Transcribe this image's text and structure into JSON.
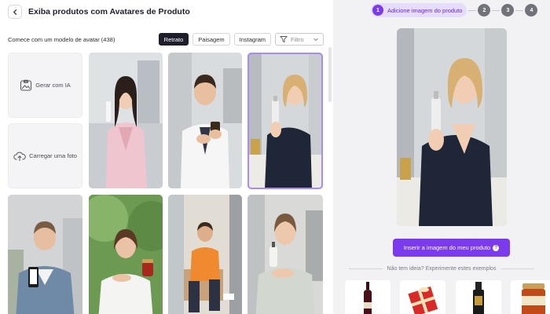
{
  "header": {
    "title": "Exiba produtos com Avatares de Produto"
  },
  "toolbar": {
    "subtitle": "Comece com um modelo de avatar (438)",
    "chips": [
      "Retrato",
      "Paisagem",
      "Instagram"
    ],
    "filter_label": "Filtro"
  },
  "tiles": {
    "generate_label": "Gerar com IA",
    "upload_label": "Carregar uma foto"
  },
  "avatars": [
    {
      "name": "woman-robe-serum",
      "selected": false
    },
    {
      "name": "man-labcoat-jar",
      "selected": false
    },
    {
      "name": "woman-blonde-dropper",
      "selected": true
    },
    {
      "name": "man-phone",
      "selected": false
    },
    {
      "name": "woman-jar-outdoor",
      "selected": false
    },
    {
      "name": "man-chair-orange",
      "selected": false
    },
    {
      "name": "woman-pump-bottle",
      "selected": false
    }
  ],
  "stepper": {
    "steps": [
      {
        "num": "1",
        "label": "Adicione imagem do produto",
        "active": true
      },
      {
        "num": "2",
        "label": "",
        "active": false
      },
      {
        "num": "3",
        "label": "",
        "active": false
      },
      {
        "num": "4",
        "label": "",
        "active": false
      }
    ]
  },
  "cta": {
    "label": "Inserir a imagem do meu produto"
  },
  "examples": {
    "label": "Não tem ideia? Experimente estes exemplos",
    "items": [
      "wine-bottle",
      "gift-box",
      "serum-bottle",
      "jam-jar"
    ]
  },
  "colors": {
    "accent": "#7c3aed",
    "accent_soft": "#e6dcfb",
    "dark_chip": "#1e1e2b",
    "panel_bg": "#f2f2f5"
  }
}
